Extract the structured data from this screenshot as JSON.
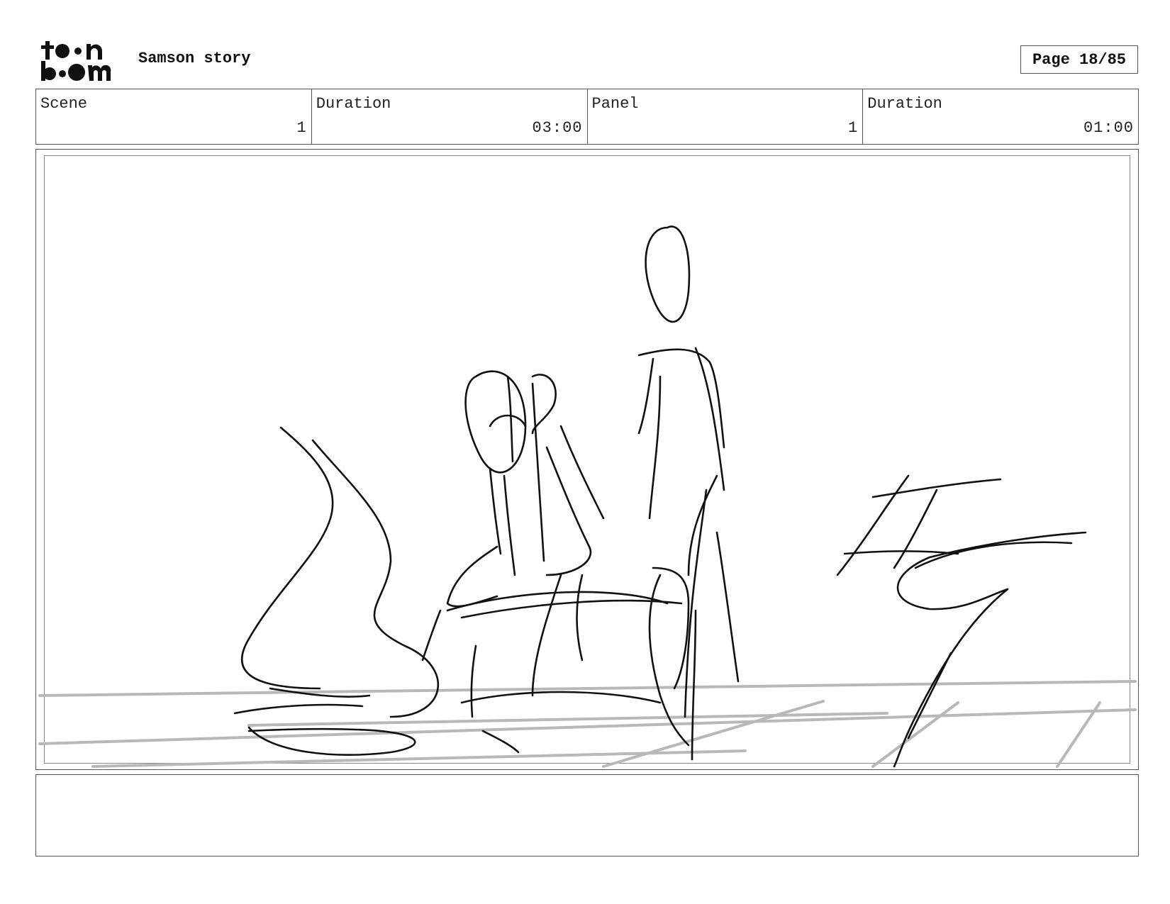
{
  "header": {
    "logo_text": "toon boom",
    "title": "Samson story",
    "page_label": "Page 18/85"
  },
  "info": {
    "scene_label": "Scene",
    "scene_value": "1",
    "scene_duration_label": "Duration",
    "scene_duration_value": "03:00",
    "panel_label": "Panel",
    "panel_value": "1",
    "panel_duration_label": "Duration",
    "panel_duration_value": "01:00"
  },
  "notes": {
    "text": ""
  }
}
